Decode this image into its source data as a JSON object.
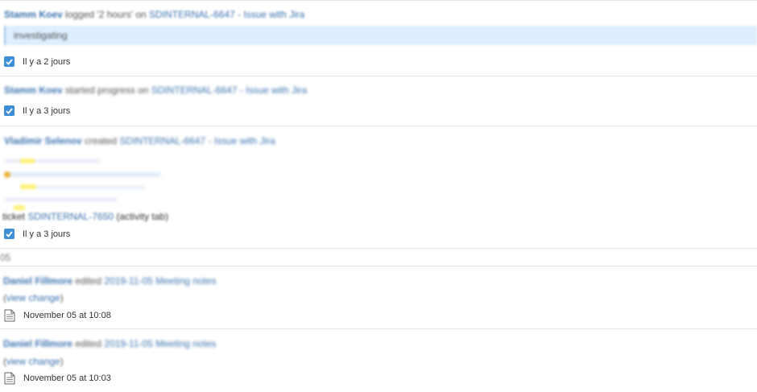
{
  "feed": {
    "e1": {
      "user": "Stamm Koev",
      "verb": " logged '2 hours' on ",
      "target": "SDINTERNAL-6647 - Issue with Jira",
      "quote": "investigating",
      "time": "Il y a 2 jours"
    },
    "e2": {
      "user": "Stamm Koev",
      "verb": " started progress on ",
      "target": "SDINTERNAL-6647 - Issue with Jira",
      "time": "Il y a 3 jours"
    },
    "e3": {
      "user": "Vladimir Selenov",
      "verb": " created ",
      "target": "SDINTERNAL-6647 - Issue with Jira",
      "ticket_prefix": "ticket ",
      "ticket_link": "SDINTERNAL-7650",
      "ticket_suffix": " (activity tab)",
      "time": "Il y a 3 jours"
    },
    "day_separator": "05",
    "e4": {
      "user": "Daniel Fillmore",
      "verb": " edited ",
      "target": "2019-11-05 Meeting notes",
      "view_change": "view change",
      "time": "November 05 at 10:08"
    },
    "e5": {
      "user": "Daniel Fillmore",
      "verb": " edited ",
      "target": "2019-11-05 Meeting notes",
      "view_change": "view change",
      "time": "November 05 at 10:03"
    }
  },
  "colors": {
    "accent": "#3b73af",
    "checkbox": "#3d8fd6",
    "quote_bg": "#ddeeff",
    "highlight": "#fff27a"
  },
  "icons": {
    "resolved": "checkbox-checked-icon",
    "page": "document-icon"
  }
}
